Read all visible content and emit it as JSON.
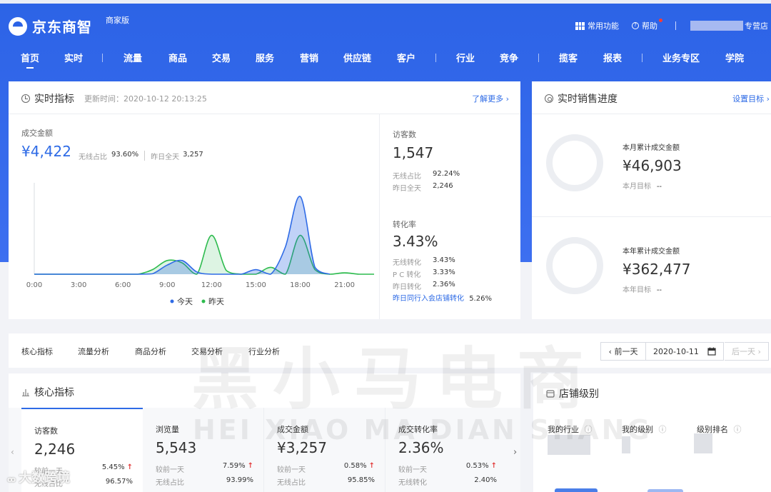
{
  "header": {
    "logo_text": "京东商智",
    "edition": "商家版",
    "common_features": "常用功能",
    "help": "帮助",
    "shop_suffix": "专营店"
  },
  "nav": {
    "tabs": [
      "首页",
      "实时",
      "流量",
      "商品",
      "交易",
      "服务",
      "营销",
      "供应链",
      "客户",
      "行业",
      "竞争",
      "揽客",
      "报表",
      "业务专区",
      "学院"
    ]
  },
  "realtime": {
    "title": "实时指标",
    "update_time": "更新时间：2020-10-12 20:13:25",
    "learn_more": "了解更多 ›",
    "gmv_label": "成交金额",
    "gmv_value": "¥4,422",
    "gmv_wireless_label": "无线占比",
    "gmv_wireless": "93.60%",
    "gmv_yesterday_label": "昨日全天",
    "gmv_yesterday": "3,257",
    "legend_today": "今天",
    "legend_yesterday": "昨天",
    "visitors_label": "访客数",
    "visitors_value": "1,547",
    "visitors_wireless_label": "无线占比",
    "visitors_wireless": "92.24%",
    "visitors_yesterday_label": "昨日全天",
    "visitors_yesterday": "2,246",
    "conv_label": "转化率",
    "conv_value": "3.43%",
    "conv_wireless_label": "无线转化",
    "conv_wireless": "3.43%",
    "conv_pc_label": "P C 转化",
    "conv_pc": "3.33%",
    "conv_yesterday_label": "昨日转化",
    "conv_yesterday": "2.36%",
    "industry_conv_label": "昨日同行入会店铺转化",
    "industry_conv": "5.26%",
    "colors": {
      "today": "#2f6be6",
      "yesterday": "#2dbb4e"
    }
  },
  "chart_data": {
    "type": "line",
    "x": [
      "0:00",
      "1:00",
      "2:00",
      "3:00",
      "4:00",
      "5:00",
      "6:00",
      "7:00",
      "8:00",
      "9:00",
      "10:00",
      "11:00",
      "12:00",
      "13:00",
      "14:00",
      "15:00",
      "16:00",
      "17:00",
      "18:00",
      "19:00",
      "20:00",
      "21:00",
      "22:00",
      "23:00"
    ],
    "xticks": [
      "0:00",
      "3:00",
      "6:00",
      "9:00",
      "12:00",
      "15:00",
      "18:00",
      "21:00"
    ],
    "series": [
      {
        "name": "今天",
        "values": [
          0,
          0,
          0,
          0,
          0,
          0,
          0,
          0,
          10,
          200,
          300,
          50,
          0,
          0,
          0,
          100,
          0,
          600,
          1700,
          150,
          0
        ]
      },
      {
        "name": "昨天",
        "values": [
          0,
          0,
          0,
          0,
          0,
          0,
          0,
          0,
          100,
          300,
          250,
          0,
          850,
          80,
          0,
          0,
          150,
          0,
          850,
          100,
          0,
          30,
          0,
          0
        ]
      }
    ],
    "ylim": [
      0,
      2000
    ],
    "grid": false,
    "legend": "bottom"
  },
  "sales_progress": {
    "title": "实时销售进度",
    "set_target": "设置目标 ›",
    "month_label": "本月累计成交金额",
    "month_value": "¥46,903",
    "month_target_label": "本月目标",
    "month_target": "--",
    "year_label": "本年累计成交金额",
    "year_value": "¥362,477",
    "year_target_label": "本年目标",
    "year_target": "--"
  },
  "subtabs": {
    "items": [
      "核心指标",
      "流量分析",
      "商品分析",
      "交易分析",
      "行业分析"
    ],
    "prev_day": "‹ 前一天",
    "date": "2020-10-11",
    "next_day": "后一天 ›"
  },
  "core": {
    "title": "核心指标",
    "kpis": [
      {
        "label": "访客数",
        "value": "2,246",
        "r1_label": "较前一天",
        "r1_value": "5.45%",
        "r2_label": "无线占比",
        "r2_value": "96.57%"
      },
      {
        "label": "浏览量",
        "value": "5,543",
        "r1_label": "较前一天",
        "r1_value": "7.59%",
        "r2_label": "无线占比",
        "r2_value": "93.99%"
      },
      {
        "label": "成交金额",
        "value": "¥3,257",
        "r1_label": "较前一天",
        "r1_value": "0.58%",
        "r2_label": "无线占比",
        "r2_value": "95.85%"
      },
      {
        "label": "成交转化率",
        "value": "2.36%",
        "r1_label": "较前一天",
        "r1_value": "0.53%",
        "r2_label": "无线转化",
        "r2_value": "2.40%"
      }
    ]
  },
  "shop_level": {
    "title": "店铺级别",
    "my_industry": "我的行业",
    "my_level": "我的级别",
    "level_rank": "级别排名"
  },
  "overlay": {
    "watermark": "黑小马电商",
    "watermark_sub": "HEI XIAO MA DIAN SHANG",
    "corner_text": "大数跨境"
  }
}
